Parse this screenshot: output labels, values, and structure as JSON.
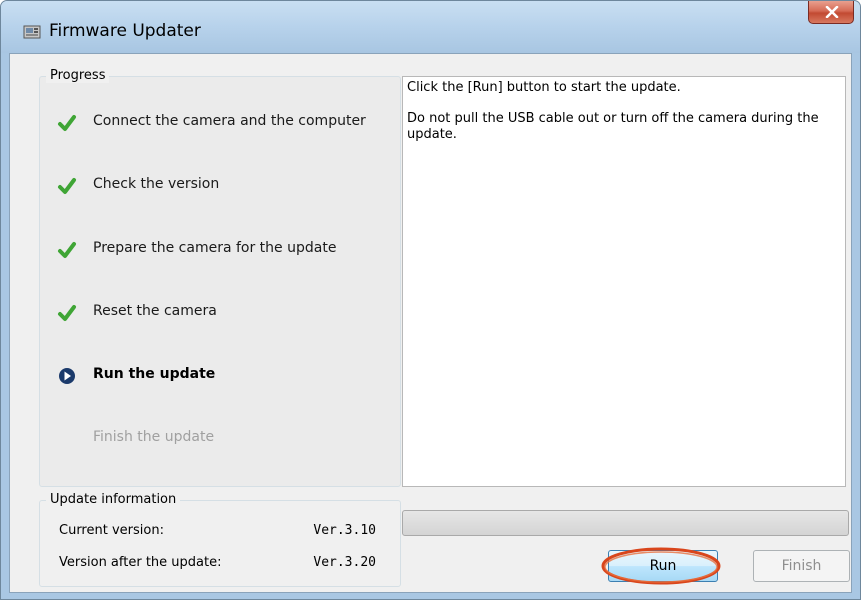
{
  "window": {
    "title": "Firmware Updater",
    "close_icon": "close-icon"
  },
  "progress": {
    "label": "Progress",
    "steps": [
      {
        "label": "Connect the camera and the computer",
        "state": "done",
        "icon": "check-icon"
      },
      {
        "label": "Check the version",
        "state": "done",
        "icon": "check-icon"
      },
      {
        "label": "Prepare the camera for the update",
        "state": "done",
        "icon": "check-icon"
      },
      {
        "label": "Reset the camera",
        "state": "done",
        "icon": "check-icon"
      },
      {
        "label": "Run the update",
        "state": "current",
        "icon": "play-circle-icon"
      },
      {
        "label": "Finish the update",
        "state": "pending",
        "icon": ""
      }
    ]
  },
  "message": {
    "line1": "Click the [Run] button to start the update.",
    "line2": "Do not pull the USB cable out or turn off the camera during the update."
  },
  "update_info": {
    "label": "Update information",
    "current_label": "Current version:",
    "current_value": "Ver.3.10",
    "after_label": "Version after the update:",
    "after_value": "Ver.3.20"
  },
  "progress_bar": {
    "value": 0
  },
  "buttons": {
    "run": "Run",
    "finish": "Finish"
  },
  "colors": {
    "check": "#3fa535",
    "current": "#1b3a6b",
    "highlight": "#d9461c"
  }
}
